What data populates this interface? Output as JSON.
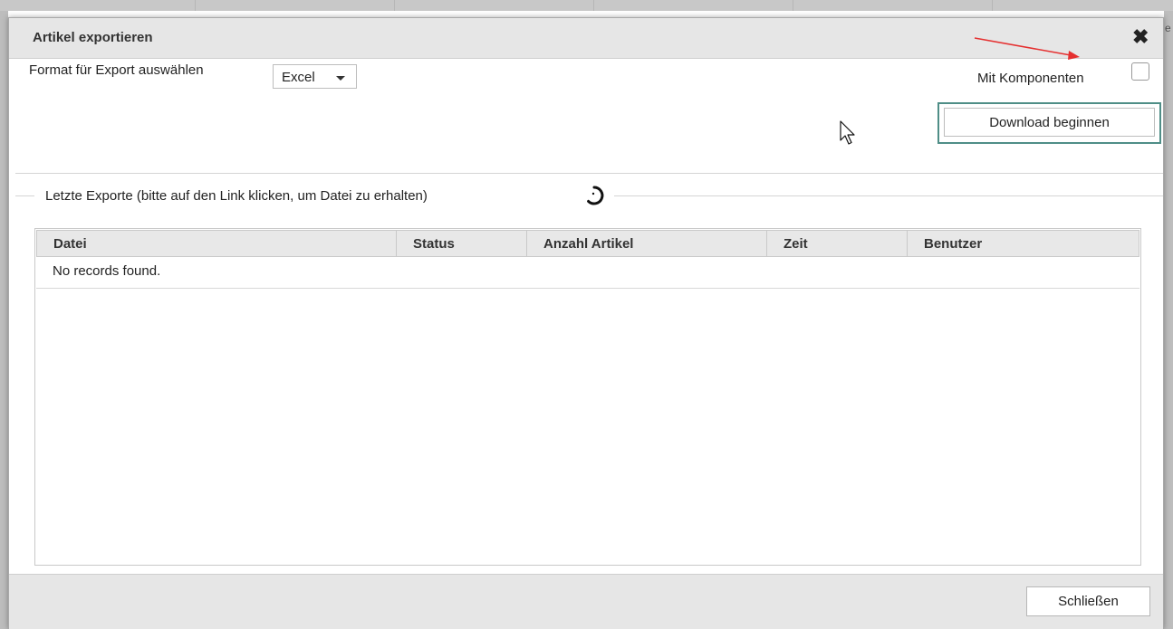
{
  "dialog": {
    "title": "Artikel exportieren"
  },
  "export": {
    "format_label": "Format für Export auswählen",
    "format_value": "Excel",
    "with_components_label": "Mit Komponenten",
    "with_components_checked": false,
    "download_label": "Download beginnen"
  },
  "recent": {
    "legend": "Letzte Exporte (bitte auf den Link klicken, um Datei zu erhalten)",
    "columns": [
      "Datei",
      "Status",
      "Anzahl Artikel",
      "Zeit",
      "Benutzer"
    ],
    "empty_text": "No records found."
  },
  "footer": {
    "close_label": "Schließen"
  },
  "colors": {
    "accent_border": "#4f8e87",
    "annotation_arrow": "#e53030"
  }
}
